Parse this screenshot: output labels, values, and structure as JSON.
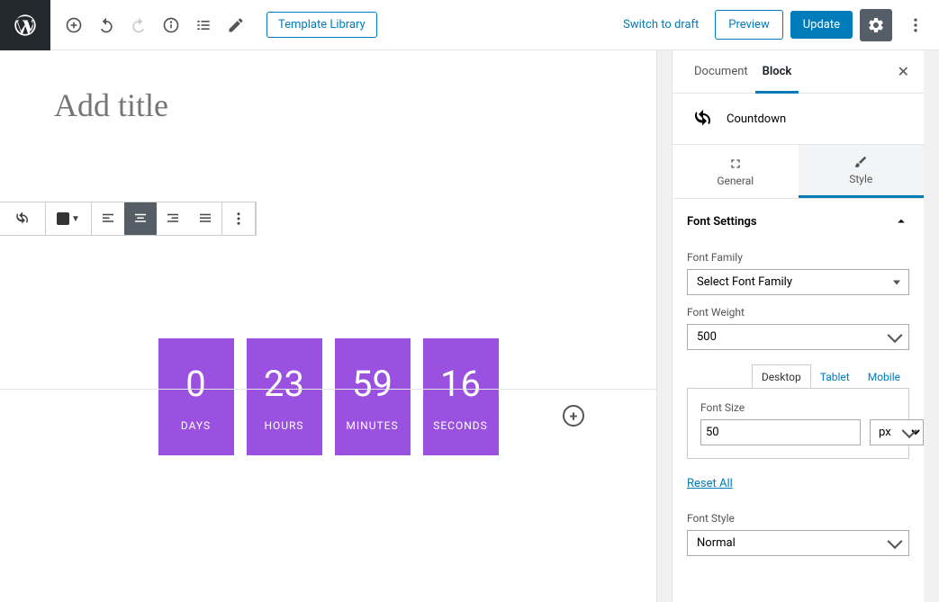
{
  "topbar": {
    "template_library": "Template Library",
    "switch_draft": "Switch to draft",
    "preview": "Preview",
    "update": "Update"
  },
  "editor": {
    "title_placeholder": "Add title"
  },
  "countdown": {
    "days_val": "0",
    "days_label": "DAYS",
    "hours_val": "23",
    "hours_label": "HOURS",
    "minutes_val": "59",
    "minutes_label": "MINUTES",
    "seconds_val": "16",
    "seconds_label": "SECONDS"
  },
  "sidebar": {
    "tab_document": "Document",
    "tab_block": "Block",
    "block_name": "Countdown",
    "tab_general": "General",
    "tab_style": "Style",
    "panel_title": "Font Settings",
    "font_family_label": "Font Family",
    "font_family_value": "Select Font Family",
    "font_weight_label": "Font Weight",
    "font_weight_value": "500",
    "device_desktop": "Desktop",
    "device_tablet": "Tablet",
    "device_mobile": "Mobile",
    "font_size_label": "Font Size",
    "font_size_value": "50",
    "font_size_unit": "px",
    "reset_all": "Reset All",
    "font_style_label": "Font Style",
    "font_style_value": "Normal"
  }
}
